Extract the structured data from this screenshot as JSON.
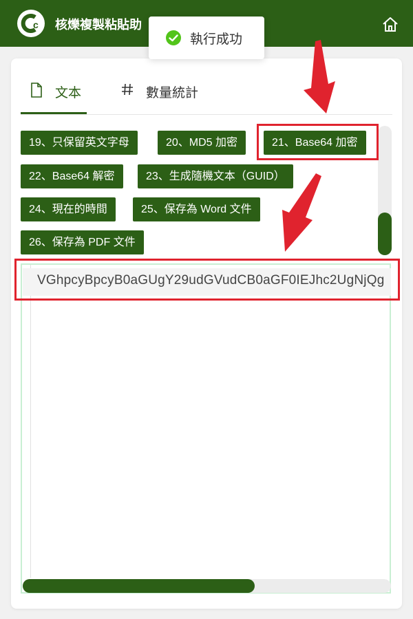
{
  "header": {
    "title": "核爍複製粘貼助",
    "logo_icon": "copy-circle-logo",
    "home_icon": "home-icon",
    "bg_color": "#2c5f16"
  },
  "toast": {
    "icon": "check-circle-icon",
    "text": "執行成功",
    "icon_color": "#52c41a"
  },
  "tabs": [
    {
      "label": "文本",
      "icon": "file-icon",
      "active": true
    },
    {
      "label": "數量統計",
      "icon": "hash-icon",
      "active": false
    }
  ],
  "function_buttons": [
    "19、只保留英文字母",
    "20、MD5 加密",
    "21、Base64 加密",
    "22、Base64 解密",
    "23、生成隨機文本（GUID）",
    "24、現在的時間",
    "25、保存為 Word 文件",
    "26、保存為 PDF 文件"
  ],
  "editor": {
    "output": "VGhpcyBpcyB0aGUgY29udGVudCB0aGF0IEJhc2UgNjQg",
    "hscroll_fraction": 0.63
  },
  "annotations": {
    "highlight_color": "#e0232e"
  }
}
